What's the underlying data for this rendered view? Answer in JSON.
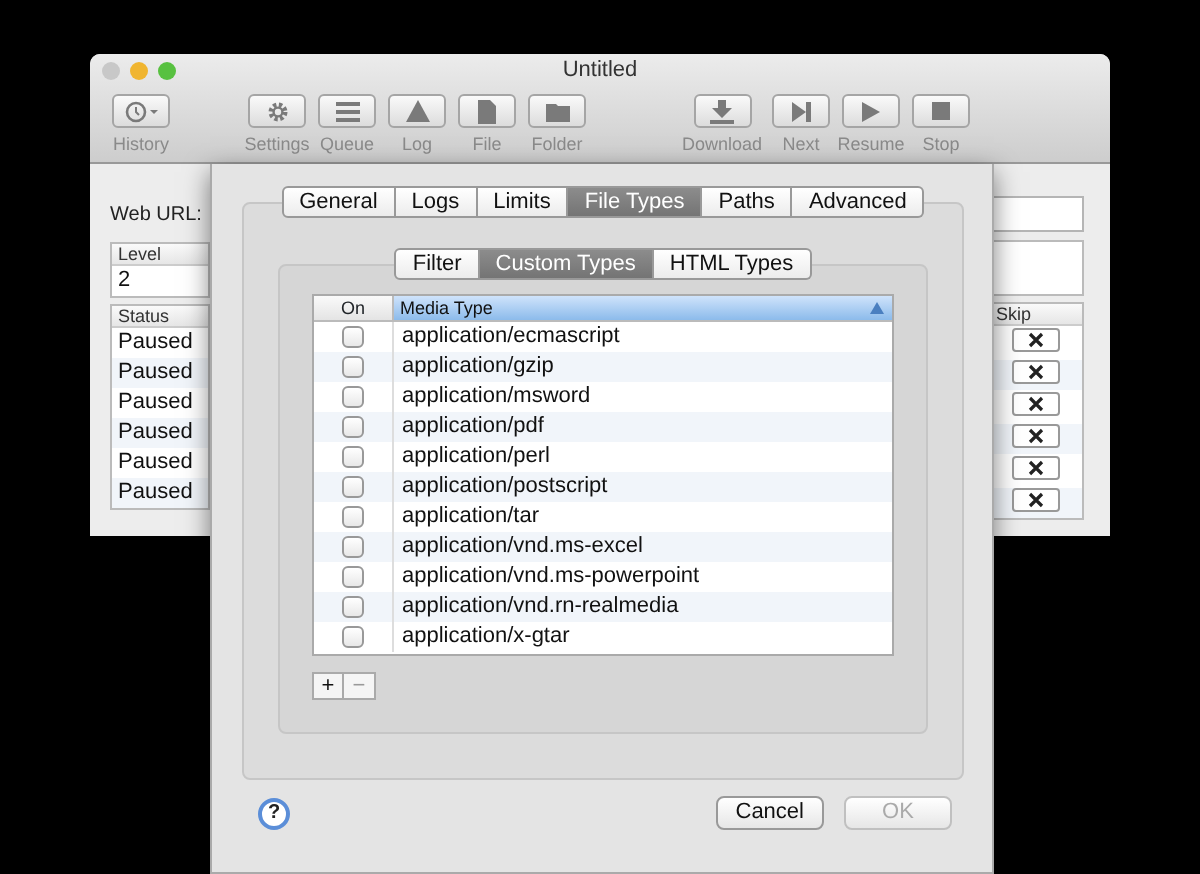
{
  "window": {
    "title": "Untitled"
  },
  "toolbar": [
    {
      "label": "History",
      "kind": "history"
    },
    {
      "label": "Settings",
      "kind": "settings"
    },
    {
      "label": "Queue",
      "kind": "queue"
    },
    {
      "label": "Log",
      "kind": "log"
    },
    {
      "label": "File",
      "kind": "file"
    },
    {
      "label": "Folder",
      "kind": "folder"
    },
    {
      "label": "Download",
      "kind": "download"
    },
    {
      "label": "Next",
      "kind": "next"
    },
    {
      "label": "Resume",
      "kind": "resume"
    },
    {
      "label": "Stop",
      "kind": "stop"
    }
  ],
  "web_url": {
    "label": "Web URL:"
  },
  "level_table": {
    "column": "Level",
    "value": "2"
  },
  "queue_table": {
    "columns": [
      "Status",
      "Skip"
    ],
    "rows": [
      {
        "status": "Paused"
      },
      {
        "status": "Paused"
      },
      {
        "status": "Paused"
      },
      {
        "status": "Paused"
      },
      {
        "status": "Paused"
      },
      {
        "status": "Paused"
      }
    ]
  },
  "sheet": {
    "tabs": [
      {
        "label": "General",
        "selected": false
      },
      {
        "label": "Logs",
        "selected": false
      },
      {
        "label": "Limits",
        "selected": false
      },
      {
        "label": "File Types",
        "selected": true
      },
      {
        "label": "Paths",
        "selected": false
      },
      {
        "label": "Advanced",
        "selected": false
      }
    ],
    "subtabs": [
      {
        "label": "Filter",
        "selected": false
      },
      {
        "label": "Custom Types",
        "selected": true
      },
      {
        "label": "HTML Types",
        "selected": false
      }
    ],
    "table": {
      "columns": [
        "On",
        "Media Type"
      ],
      "rows": [
        {
          "checked": false,
          "media_type": "application/ecmascript"
        },
        {
          "checked": false,
          "media_type": "application/gzip"
        },
        {
          "checked": false,
          "media_type": "application/msword"
        },
        {
          "checked": false,
          "media_type": "application/pdf"
        },
        {
          "checked": false,
          "media_type": "application/perl"
        },
        {
          "checked": false,
          "media_type": "application/postscript"
        },
        {
          "checked": false,
          "media_type": "application/tar"
        },
        {
          "checked": false,
          "media_type": "application/vnd.ms-excel"
        },
        {
          "checked": false,
          "media_type": "application/vnd.ms-powerpoint"
        },
        {
          "checked": false,
          "media_type": "application/vnd.rn-realmedia"
        },
        {
          "checked": false,
          "media_type": "application/x-gtar"
        }
      ]
    },
    "add_button": "+",
    "remove_button": "−",
    "help": "?",
    "buttons": [
      {
        "label": "Cancel",
        "disabled": false
      },
      {
        "label": "OK",
        "disabled": true
      }
    ]
  }
}
